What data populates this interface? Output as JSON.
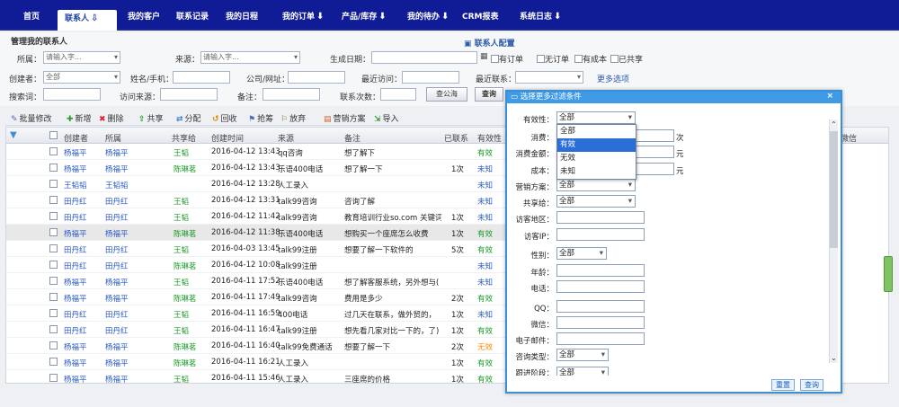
{
  "nav": {
    "items": [
      {
        "label": "首页",
        "arrow": ""
      },
      {
        "label": "联系人",
        "arrow": "⇩"
      },
      {
        "label": "我的客户",
        "arrow": ""
      },
      {
        "label": "联系记录",
        "arrow": ""
      },
      {
        "label": "我的日程",
        "arrow": ""
      },
      {
        "label": "我的订单",
        "arrow": "⬇"
      },
      {
        "label": "产品/库存",
        "arrow": "⬇"
      },
      {
        "label": "我的待办",
        "arrow": "⬇"
      },
      {
        "label": "CRM报表",
        "arrow": ""
      },
      {
        "label": "系统日志",
        "arrow": "⬇"
      }
    ]
  },
  "filters": {
    "title": "管理我的联系人",
    "config_link": "联系人配置",
    "belong_label": "所属：",
    "belong_placeholder": "请输入字...",
    "source_label": "来源：",
    "source_placeholder": "请输入字...",
    "birthday_label": "生成日期：",
    "check_ordered": "有订单",
    "check_noorder": "无订单",
    "check_cost": "有成本",
    "check_shared": "已共享",
    "creator_label": "创建者：",
    "creator_value": "全部",
    "name_label": "姓名/手机：",
    "company_label": "公司/网址：",
    "last_visit_label": "最近访问：",
    "recent_contact_label": "最近联系：",
    "more_filter": "更多选项",
    "search_word_label": "搜索词：",
    "visit_from_label": "访问来源：",
    "remark_label": "备注：",
    "contact_times_label": "联系次数：",
    "find_button": "查公海",
    "query_button": "查询"
  },
  "toolbar": {
    "batch_edit": "批量修改",
    "add": "新增",
    "delete": "删除",
    "share": "共享",
    "assign": "分配",
    "recycle": "回收",
    "claim": "抢筹",
    "discard": "放弃",
    "marketing": "营销方案",
    "import": "导入"
  },
  "grid": {
    "headers": [
      "创建者",
      "所属",
      "共享给",
      "创建时间",
      "来源",
      "备注",
      "已联系",
      "有效性",
      "微信"
    ],
    "rows": [
      {
        "creator": "杨福平",
        "owner": "杨福平",
        "share": "王韬",
        "time": "2016-04-12 13:43",
        "source": "qq咨询",
        "remark": "想了解下",
        "contacted": "",
        "validity": "有效",
        "vclass": "green"
      },
      {
        "creator": "杨福平",
        "owner": "杨福平",
        "share": "陈琳茗",
        "time": "2016-04-12 13:43",
        "source": "乐语400电话",
        "remark": "想了解一下",
        "contacted": "1次",
        "validity": "未知",
        "vclass": "blue"
      },
      {
        "creator": "王韬韬",
        "owner": "王韬韬",
        "share": "",
        "time": "2016-04-12 13:28",
        "source": "人工录入",
        "remark": "",
        "contacted": "",
        "validity": "未知",
        "vclass": "blue"
      },
      {
        "creator": "田丹红",
        "owner": "田丹红",
        "share": "王韬",
        "time": "2016-04-12 13:31",
        "source": "talk99咨询",
        "remark": "咨询了解",
        "contacted": "",
        "validity": "未知",
        "vclass": "blue"
      },
      {
        "creator": "田丹红",
        "owner": "田丹红",
        "share": "王韬",
        "time": "2016-04-12 11:42",
        "source": "talk99咨询",
        "remark": "教育培训行业so.com 关键词",
        "contacted": "1次",
        "validity": "未知",
        "vclass": "blue"
      },
      {
        "creator": "杨福平",
        "owner": "杨福平",
        "share": "陈琳茗",
        "time": "2016-04-12 11:38",
        "source": "乐语400电话",
        "remark": "想购买一个座席怎么收费",
        "contacted": "1次",
        "validity": "有效",
        "vclass": "green"
      },
      {
        "creator": "田丹红",
        "owner": "田丹红",
        "share": "王韬",
        "time": "2016-04-03 13:45",
        "source": "talk99注册",
        "remark": "想要了解一下软件的",
        "contacted": "5次",
        "validity": "有效",
        "vclass": "green"
      },
      {
        "creator": "田丹红",
        "owner": "田丹红",
        "share": "陈琳茗",
        "time": "2016-04-12 10:08",
        "source": "talk99注册",
        "remark": "",
        "contacted": "",
        "validity": "未知",
        "vclass": "blue"
      },
      {
        "creator": "杨福平",
        "owner": "杨福平",
        "share": "王韬",
        "time": "2016-04-11 17:52",
        "source": "乐语400电话",
        "remark": "想了解客服系统，另外想与(",
        "contacted": "",
        "validity": "未知",
        "vclass": "blue"
      },
      {
        "creator": "杨福平",
        "owner": "杨福平",
        "share": "陈琳茗",
        "time": "2016-04-11 17:49",
        "source": "talk99咨询",
        "remark": "费用是多少",
        "contacted": "2次",
        "validity": "有效",
        "vclass": "green"
      },
      {
        "creator": "田丹红",
        "owner": "田丹红",
        "share": "王韬",
        "time": "2016-04-11 16:59",
        "source": "400电话",
        "remark": "过几天在联系，做外贸的，",
        "contacted": "1次",
        "validity": "未知",
        "vclass": "blue"
      },
      {
        "creator": "田丹红",
        "owner": "田丹红",
        "share": "王韬",
        "time": "2016-04-11 16:47",
        "source": "talk99注册",
        "remark": "想先看几家对比一下的，了)",
        "contacted": "1次",
        "validity": "有效",
        "vclass": "green"
      },
      {
        "creator": "杨福平",
        "owner": "杨福平",
        "share": "陈琳茗",
        "time": "2016-04-11 16:40",
        "source": "talk99免费通话",
        "remark": "想要了解一下",
        "contacted": "2次",
        "validity": "无效",
        "vclass": "orange"
      },
      {
        "creator": "杨福平",
        "owner": "杨福平",
        "share": "陈琳茗",
        "time": "2016-04-11 16:21",
        "source": "人工录入",
        "remark": "",
        "contacted": "1次",
        "validity": "有效",
        "vclass": "green"
      },
      {
        "creator": "杨福平",
        "owner": "杨福平",
        "share": "王韬",
        "time": "2016-04-11 15:46",
        "source": "人工录入",
        "remark": "三座席的价格",
        "contacted": "1次",
        "validity": "有效",
        "vclass": "green"
      }
    ]
  },
  "dialog": {
    "title": "选择更多过滤条件",
    "validity_label": "有效性：",
    "validity_value": "全部",
    "options": [
      "全部",
      "有效",
      "无效",
      "未知"
    ],
    "highlighted": "有效",
    "consume_label": "消费：",
    "consume_amount_label": "消费金额：",
    "cost_label": "成本：",
    "unit_times": "次",
    "unit_yuan": "元",
    "marketing_label": "营销方案：",
    "marketing_value": "全部",
    "share_label": "共享给：",
    "share_value": "全部",
    "region_label": "访客地区：",
    "ip_label": "访客IP：",
    "gender_label": "性别：",
    "gender_value": "全部",
    "age_label": "年龄：",
    "phone_label": "电话：",
    "qq_label": "QQ：",
    "wechat_label": "微信：",
    "email_label": "电子邮件：",
    "consult_type_label": "咨询类型：",
    "consult_type_value": "全部",
    "followup_label": "跟进阶段：",
    "followup_value": "全部",
    "reset_button": "重置",
    "query_button": "查询"
  }
}
